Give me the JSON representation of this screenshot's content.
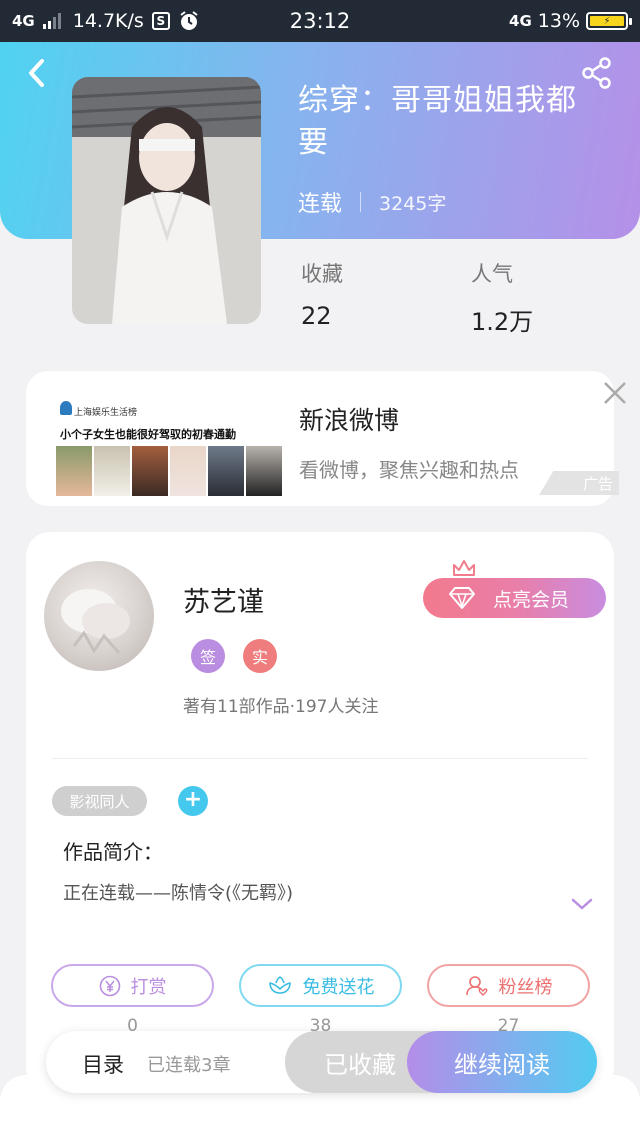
{
  "status_bar": {
    "network": "4G",
    "speed": "14.7K/s",
    "s_icon": "S",
    "time": "23:12",
    "network_right": "4G",
    "battery": "13%"
  },
  "book": {
    "title": "综穿：哥哥姐姐我都要",
    "status": "连载",
    "word_count": "3245字",
    "stats": [
      {
        "label": "收藏",
        "value": "22"
      },
      {
        "label": "人气",
        "value": "1.2万"
      }
    ]
  },
  "ad": {
    "thumb_brand": "上海娱乐生活榜",
    "thumb_headline": "小个子女生也能很好驾驭的初春通勤",
    "title": "新浪微博",
    "description": "看微博，聚焦兴趣和热点",
    "badge": "广告"
  },
  "author": {
    "name": "苏艺谨",
    "badges": [
      "签",
      "实"
    ],
    "vip_label": "点亮会员",
    "stats": "著有11部作品·197人关注",
    "tag": "影视同人",
    "tag_add": "+",
    "intro_label": "作品简介：",
    "intro_text": "正在连载——陈情令(《无羁》)"
  },
  "actions": [
    {
      "label": "打赏",
      "count": "0",
      "color": "#b98ee0",
      "icon": "yuan-icon"
    },
    {
      "label": "免费送花",
      "count": "38",
      "color": "#4bc9ea",
      "icon": "flower-icon"
    },
    {
      "label": "粉丝榜",
      "count": "27",
      "color": "#ef7d7d",
      "icon": "fans-icon"
    }
  ],
  "bottom_bar": {
    "toc_label": "目录",
    "toc_count": "已连载3章",
    "collected_label": "已收藏",
    "read_label": "继续阅读"
  }
}
